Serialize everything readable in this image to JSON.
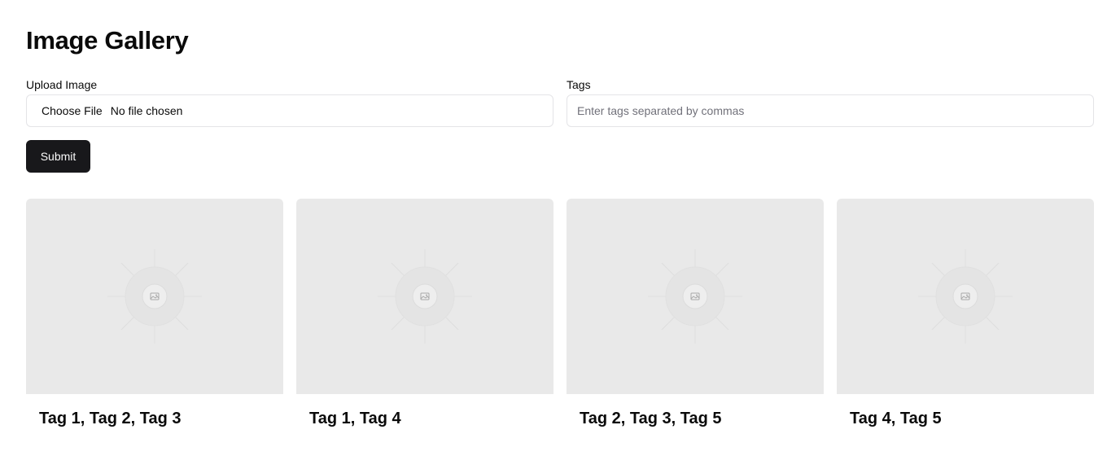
{
  "page": {
    "title": "Image Gallery"
  },
  "upload": {
    "label": "Upload Image",
    "button_label": "Choose File",
    "status": "No file chosen"
  },
  "tags": {
    "label": "Tags",
    "placeholder": "Enter tags separated by commas",
    "value": ""
  },
  "submit": {
    "label": "Submit"
  },
  "gallery": {
    "items": [
      {
        "caption": "Tag 1, Tag 2, Tag 3",
        "icon": "image-placeholder-icon"
      },
      {
        "caption": "Tag 1, Tag 4",
        "icon": "image-placeholder-icon"
      },
      {
        "caption": "Tag 2, Tag 3, Tag 5",
        "icon": "image-placeholder-icon"
      },
      {
        "caption": "Tag 4, Tag 5",
        "icon": "image-placeholder-icon"
      }
    ]
  },
  "colors": {
    "primary": "#18181b",
    "placeholder_bg": "#e9e9e9",
    "border": "#e4e4e7",
    "muted_text": "#71717a"
  }
}
